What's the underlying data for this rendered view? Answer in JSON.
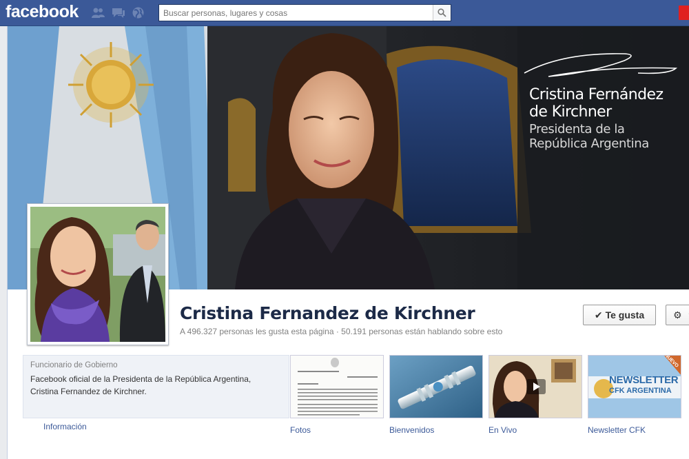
{
  "topbar": {
    "logo": "facebook",
    "search_placeholder": "Buscar personas, lugares y cosas"
  },
  "cover": {
    "title_line1": "Cristina Fernández",
    "title_line2": "de Kirchner",
    "subtitle_line1": "Presidenta de la",
    "subtitle_line2": "República Argentina"
  },
  "page": {
    "name": "Cristina Fernandez de Kirchner",
    "stats": "A 496.327 personas les gusta esta página · 50.191 personas están hablando sobre esto",
    "like_label": "Te gusta",
    "category": "Funcionario de Gobierno",
    "description_line1": "Facebook oficial de la Presidenta de la República Argentina,",
    "description_line2": "Cristina Fernandez de Kirchner.",
    "about_link": "Información"
  },
  "apps": [
    {
      "label": "Fotos"
    },
    {
      "label": "Bienvenidos"
    },
    {
      "label": "En Vivo"
    },
    {
      "label": "Newsletter CFK",
      "tile_title1": "NEWSLETTER",
      "tile_title2": "CFK ARGENTINA",
      "badge": "NUEVO"
    }
  ],
  "colors": {
    "facebook_blue": "#3b5998",
    "link": "#3b5998",
    "name": "#1c2a47"
  }
}
